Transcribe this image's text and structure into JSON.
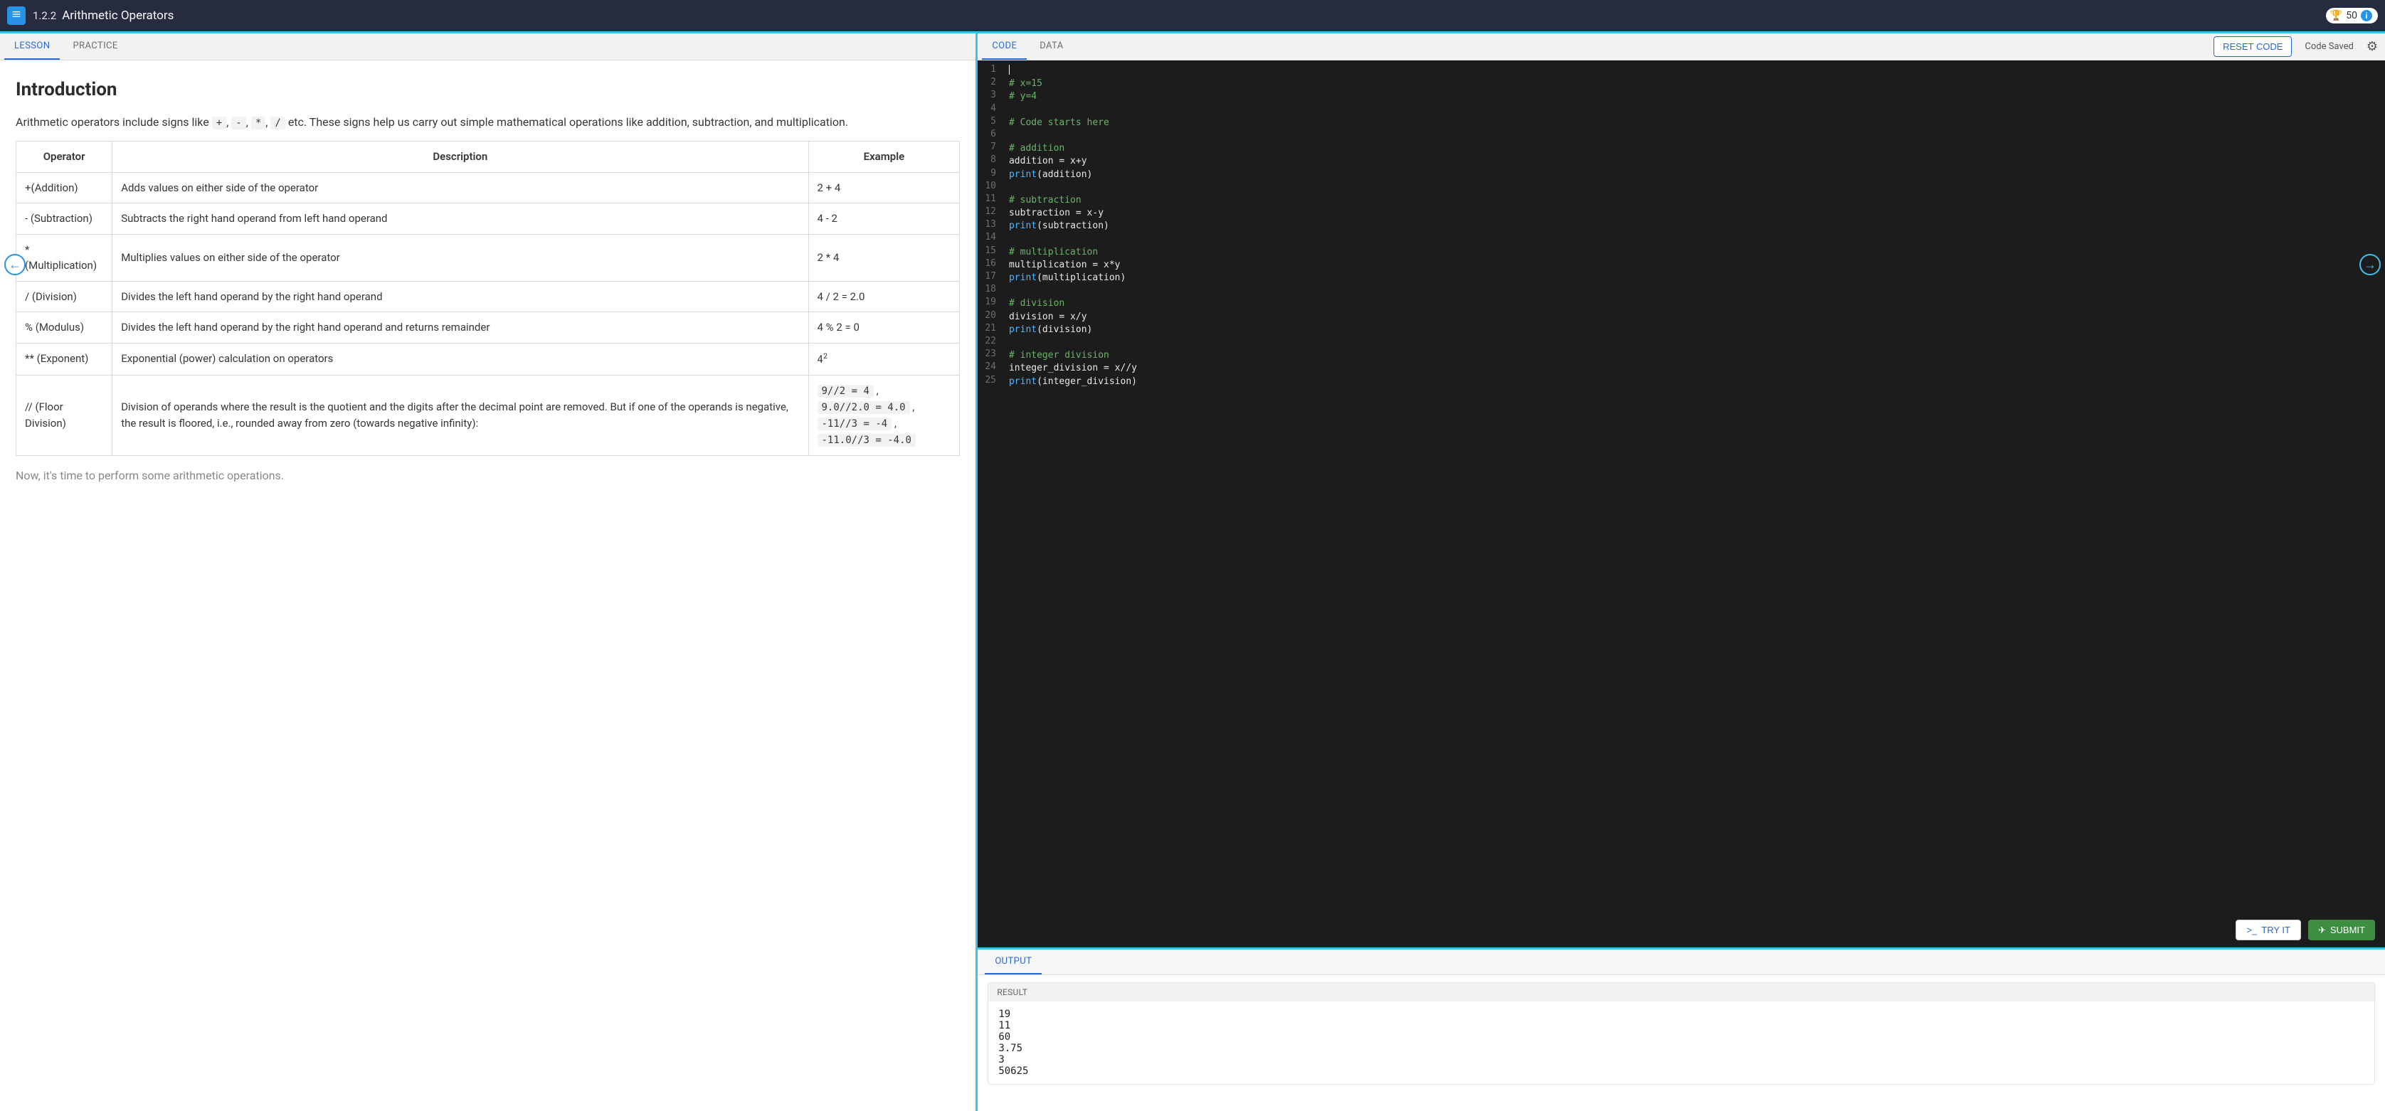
{
  "topbar": {
    "lesson_number": "1.2.2",
    "lesson_title": "Arithmetic Operators",
    "points": "50"
  },
  "left": {
    "tabs": {
      "lesson": "LESSON",
      "practice": "PRACTICE"
    },
    "heading": "Introduction",
    "intro_pre": "Arithmetic operators include signs like ",
    "intro_codes": [
      "+",
      "-",
      "*",
      "/"
    ],
    "intro_post": " etc. These signs help us carry out simple mathematical operations like addition, subtraction, and multiplication.",
    "table": {
      "headers": [
        "Operator",
        "Description",
        "Example"
      ],
      "rows": [
        {
          "op": "+(Addition)",
          "desc": "Adds values on either side of the operator",
          "example": "2 + 4"
        },
        {
          "op": "- (Subtraction)",
          "desc": "Subtracts the right hand operand from left hand operand",
          "example": "4 - 2"
        },
        {
          "op": "* (Multiplication)",
          "desc": "Multiplies values on either side of the operator",
          "example": "2 * 4"
        },
        {
          "op": "/ (Division)",
          "desc": "Divides the left hand operand by the right hand operand",
          "example": "4 / 2 = 2.0"
        },
        {
          "op": "% (Modulus)",
          "desc": "Divides the left hand operand by the right hand operand and returns remainder",
          "example": "4 % 2 = 0"
        },
        {
          "op": "** (Exponent)",
          "desc": "Exponential (power) calculation on operators",
          "example_math_base": "4",
          "example_math_sup": "2"
        },
        {
          "op": "// (Floor Division)",
          "desc": "Division of operands where the result is the quotient and the digits after the decimal point are removed. But if one of the operands is negative, the result is floored, i.e., rounded away from zero (towards negative infinity):",
          "example_codes": [
            "9//2 = 4",
            "9.0//2.0 = 4.0",
            "-11//3 = -4",
            "-11.0//3 = -4.0"
          ]
        }
      ]
    },
    "footer_line": "Now, it's time to perform some arithmetic operations."
  },
  "right": {
    "tabs": {
      "code": "CODE",
      "data": "DATA"
    },
    "reset_label": "RESET CODE",
    "saved_label": "Code Saved",
    "tryit_label": "TRY IT",
    "submit_label": "SUBMIT",
    "code_lines": [
      {
        "n": 1,
        "segs": []
      },
      {
        "n": 2,
        "segs": [
          {
            "t": "cmt",
            "v": "# x=15"
          }
        ]
      },
      {
        "n": 3,
        "segs": [
          {
            "t": "cmt",
            "v": "# y=4"
          }
        ]
      },
      {
        "n": 4,
        "segs": []
      },
      {
        "n": 5,
        "segs": [
          {
            "t": "cmt",
            "v": "# Code starts here"
          }
        ]
      },
      {
        "n": 6,
        "segs": []
      },
      {
        "n": 7,
        "segs": [
          {
            "t": "cmt",
            "v": "# addition"
          }
        ]
      },
      {
        "n": 8,
        "segs": [
          {
            "t": "var",
            "v": "addition = x+y"
          }
        ]
      },
      {
        "n": 9,
        "segs": [
          {
            "t": "fn",
            "v": "print"
          },
          {
            "t": "var",
            "v": "(addition)"
          }
        ]
      },
      {
        "n": 10,
        "segs": []
      },
      {
        "n": 11,
        "segs": [
          {
            "t": "cmt",
            "v": "# subtraction"
          }
        ]
      },
      {
        "n": 12,
        "segs": [
          {
            "t": "var",
            "v": "subtraction = x-y"
          }
        ]
      },
      {
        "n": 13,
        "segs": [
          {
            "t": "fn",
            "v": "print"
          },
          {
            "t": "var",
            "v": "(subtraction)"
          }
        ]
      },
      {
        "n": 14,
        "segs": []
      },
      {
        "n": 15,
        "segs": [
          {
            "t": "cmt",
            "v": "# multiplication"
          }
        ]
      },
      {
        "n": 16,
        "segs": [
          {
            "t": "var",
            "v": "multiplication = x*y"
          }
        ]
      },
      {
        "n": 17,
        "segs": [
          {
            "t": "fn",
            "v": "print"
          },
          {
            "t": "var",
            "v": "(multiplication)"
          }
        ]
      },
      {
        "n": 18,
        "segs": []
      },
      {
        "n": 19,
        "segs": [
          {
            "t": "cmt",
            "v": "# division"
          }
        ]
      },
      {
        "n": 20,
        "segs": [
          {
            "t": "var",
            "v": "division = x/y"
          }
        ]
      },
      {
        "n": 21,
        "segs": [
          {
            "t": "fn",
            "v": "print"
          },
          {
            "t": "var",
            "v": "(division)"
          }
        ]
      },
      {
        "n": 22,
        "segs": []
      },
      {
        "n": 23,
        "segs": [
          {
            "t": "cmt",
            "v": "# integer division"
          }
        ]
      },
      {
        "n": 24,
        "segs": [
          {
            "t": "var",
            "v": "integer_division = x//y"
          }
        ]
      },
      {
        "n": 25,
        "segs": [
          {
            "t": "fn",
            "v": "print"
          },
          {
            "t": "var",
            "v": "(integer_division)"
          }
        ]
      }
    ]
  },
  "output": {
    "tab": "OUTPUT",
    "result_label": "RESULT",
    "result_lines": [
      "19",
      "11",
      "60",
      "3.75",
      "3",
      "50625"
    ]
  }
}
